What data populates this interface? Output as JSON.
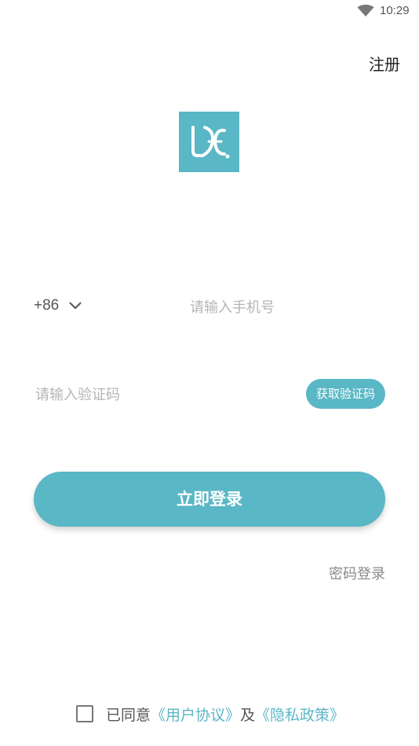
{
  "status_bar": {
    "time": "10:29",
    "wifi_icon": "wifi-icon"
  },
  "header": {
    "register_label": "注册"
  },
  "logo": {
    "icon": "brand-logo",
    "color": "#5ab7c5"
  },
  "phone": {
    "country_code": "+86",
    "dropdown_icon": "chevron-down-icon",
    "placeholder": "请输入手机号",
    "value": ""
  },
  "verification": {
    "placeholder": "请输入验证码",
    "value": "",
    "get_code_label": "获取验证码"
  },
  "login": {
    "submit_label": "立即登录",
    "password_login_label": "密码登录"
  },
  "agreement": {
    "prefix": "已同意",
    "user_agreement": "《用户协议》",
    "conjunction": "及",
    "privacy_policy": "《隐私政策》",
    "checked": false
  },
  "colors": {
    "accent": "#5ab7c5",
    "placeholder": "#b5b5b5",
    "secondary_text": "#8a8a8a"
  }
}
